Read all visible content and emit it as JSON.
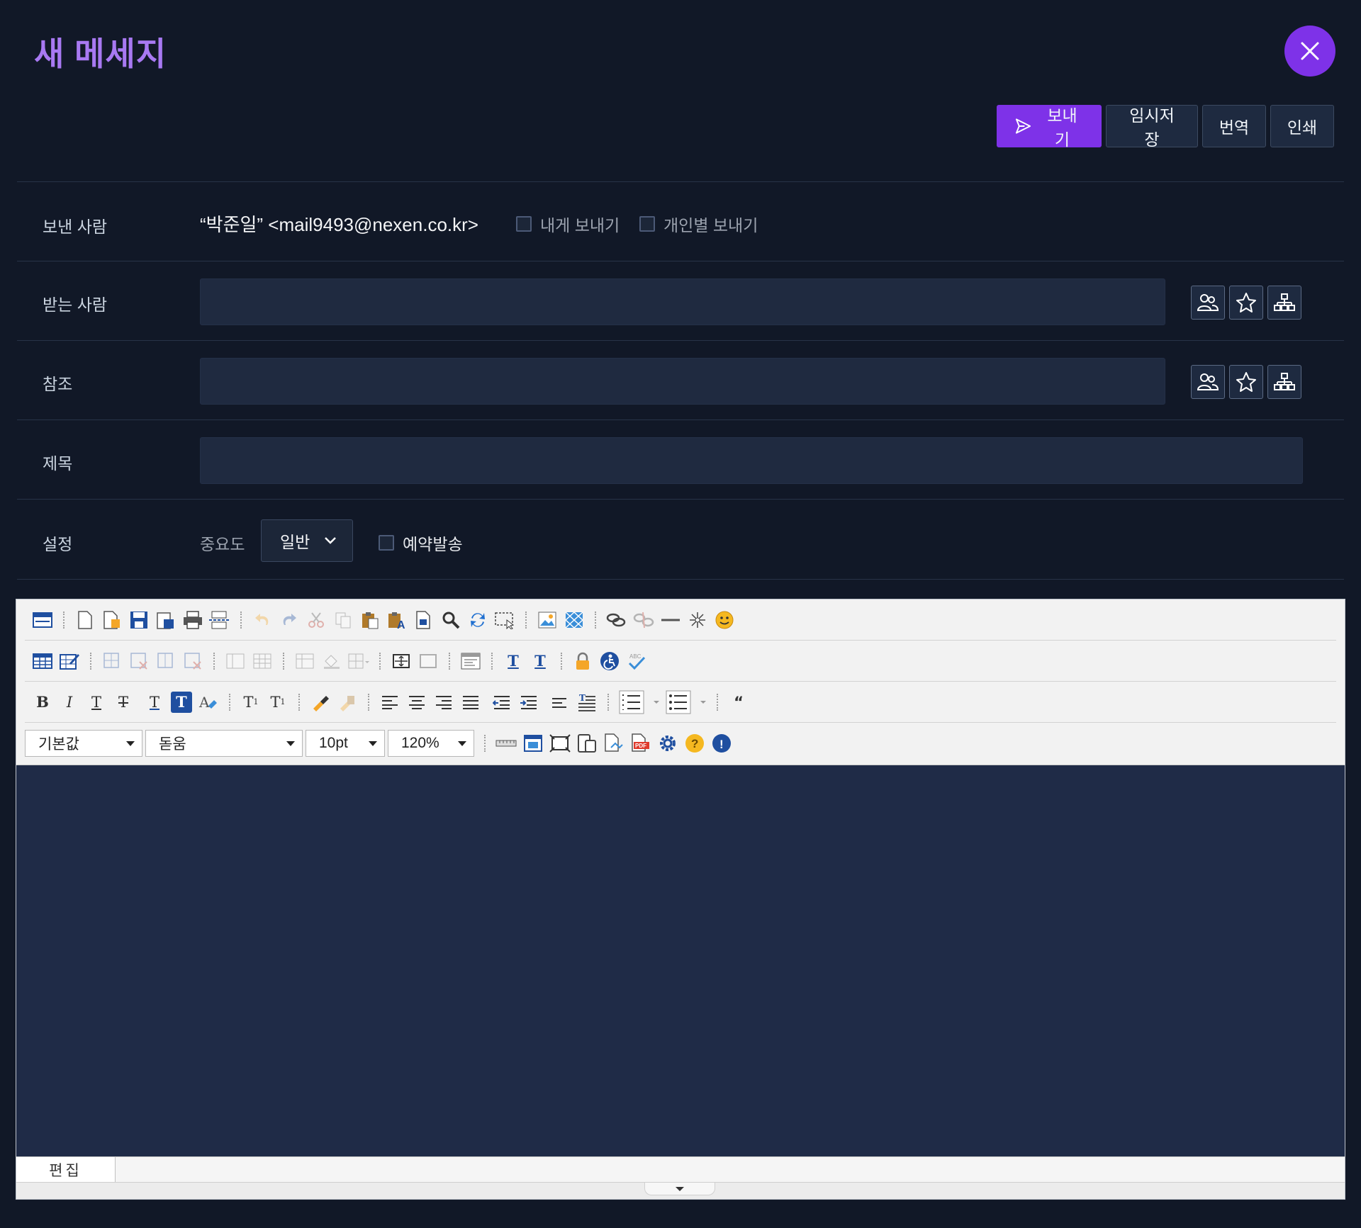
{
  "title": "새 메세지",
  "actions": {
    "send": "보내기",
    "draft": "임시저장",
    "translate": "번역",
    "print": "인쇄"
  },
  "sender": {
    "label": "보낸 사람",
    "value": "“박준일” <mail9493@nexen.co.kr>",
    "send_to_me": "내게 보내기",
    "send_individually": "개인별 보내기"
  },
  "recipient": {
    "label": "받는 사람",
    "value": ""
  },
  "cc": {
    "label": "참조",
    "value": ""
  },
  "subject": {
    "label": "제목",
    "value": ""
  },
  "settings": {
    "label": "설정",
    "priority_label": "중요도",
    "priority_value": "일반",
    "scheduled": "예약발송"
  },
  "editor": {
    "style_select": "기본값",
    "font_select": "돋움",
    "size_select": "10pt",
    "line_height_select": "120%",
    "tab_edit": "편집"
  }
}
